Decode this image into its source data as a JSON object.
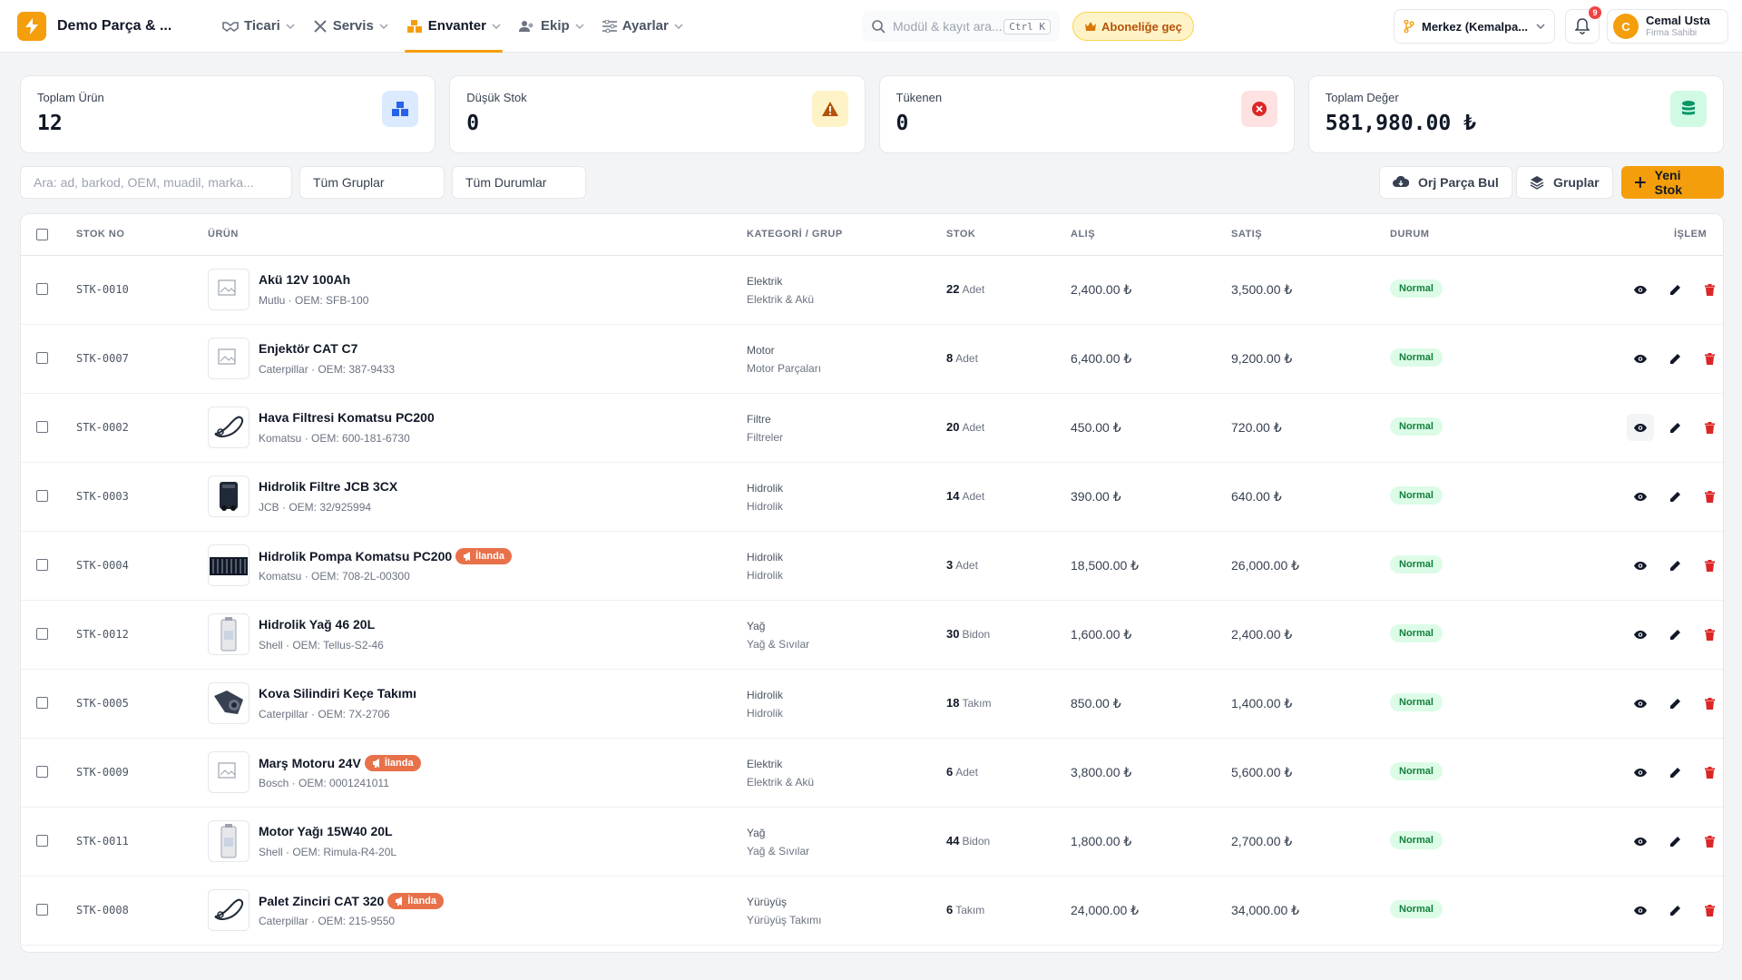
{
  "brand": {
    "name": "Demo Parça & ..."
  },
  "nav": [
    {
      "label": "Ticari",
      "icon": "handshake-icon"
    },
    {
      "label": "Servis",
      "icon": "wrench-icon"
    },
    {
      "label": "Envanter",
      "icon": "boxes-icon",
      "active": true
    },
    {
      "label": "Ekip",
      "icon": "users-icon"
    },
    {
      "label": "Ayarlar",
      "icon": "sliders-icon"
    }
  ],
  "search": {
    "placeholder": "Modül & kayıt ara...",
    "shortcut": "Ctrl K"
  },
  "subscribe": {
    "label": "Aboneliğe geç"
  },
  "branch": {
    "label": "Merkez (Kemalpa..."
  },
  "notifications": {
    "count": "9"
  },
  "user": {
    "initial": "C",
    "name": "Cemal Usta",
    "role": "Firma Sahibi"
  },
  "stats": [
    {
      "label": "Toplam Ürün",
      "value": "12",
      "icon": "boxes-icon",
      "color": "#2563eb",
      "bg": "#dbeafe"
    },
    {
      "label": "Düşük Stok",
      "value": "0",
      "icon": "warning-icon",
      "color": "#b45309",
      "bg": "#fef3c7"
    },
    {
      "label": "Tükenen",
      "value": "0",
      "icon": "x-circle-icon",
      "color": "#dc2626",
      "bg": "#fee2e2"
    },
    {
      "label": "Toplam Değer",
      "value": "581,980.00 ₺",
      "icon": "coins-icon",
      "color": "#059669",
      "bg": "#d1fae5"
    }
  ],
  "filters": {
    "search_placeholder": "Ara: ad, barkod, OEM, muadil, marka...",
    "group_select": "Tüm Gruplar",
    "status_select": "Tüm Durumlar",
    "find_part": "Orj Parça Bul",
    "groups": "Gruplar",
    "new_stock": "Yeni Stok"
  },
  "table": {
    "headers": {
      "stock_no": "STOK NO",
      "product": "ÜRÜN",
      "category": "KATEGORİ / GRUP",
      "stock": "STOK",
      "buy": "ALIŞ",
      "sell": "SATIŞ",
      "status": "DURUM",
      "action": "İŞLEM"
    },
    "listing_badge": "İlanda",
    "rows": [
      {
        "code": "STK-0010",
        "name": "Akü 12V 100Ah",
        "sub": "Mutlu · OEM: SFB-100",
        "cat": "Elektrik",
        "group": "Elektrik & Akü",
        "qty": "22",
        "unit": "Adet",
        "buy": "2,400.00 ₺",
        "sell": "3,500.00 ₺",
        "status": "Normal",
        "listed": false,
        "thumb": "broken-image-icon"
      },
      {
        "code": "STK-0007",
        "name": "Enjektör CAT C7",
        "sub": "Caterpillar · OEM: 387-9433",
        "cat": "Motor",
        "group": "Motor Parçaları",
        "qty": "8",
        "unit": "Adet",
        "buy": "6,400.00 ₺",
        "sell": "9,200.00 ₺",
        "status": "Normal",
        "listed": false,
        "thumb": "broken-image-icon"
      },
      {
        "code": "STK-0002",
        "name": "Hava Filtresi Komatsu PC200",
        "sub": "Komatsu · OEM: 600-181-6730",
        "cat": "Filtre",
        "group": "Filtreler",
        "qty": "20",
        "unit": "Adet",
        "buy": "450.00 ₺",
        "sell": "720.00 ₺",
        "status": "Normal",
        "listed": false,
        "thumb": "chain-thumb"
      },
      {
        "code": "STK-0003",
        "name": "Hidrolik Filtre JCB 3CX",
        "sub": "JCB · OEM: 32/925994",
        "cat": "Hidrolik",
        "group": "Hidrolik",
        "qty": "14",
        "unit": "Adet",
        "buy": "390.00 ₺",
        "sell": "640.00 ₺",
        "status": "Normal",
        "listed": false,
        "thumb": "filter-thumb"
      },
      {
        "code": "STK-0004",
        "name": "Hidrolik Pompa Komatsu PC200",
        "sub": "Komatsu · OEM: 708-2L-00300",
        "cat": "Hidrolik",
        "group": "Hidrolik",
        "qty": "3",
        "unit": "Adet",
        "buy": "18,500.00 ₺",
        "sell": "26,000.00 ₺",
        "status": "Normal",
        "listed": true,
        "thumb": "pump-thumb"
      },
      {
        "code": "STK-0012",
        "name": "Hidrolik Yağ 46 20L",
        "sub": "Shell · OEM: Tellus-S2-46",
        "cat": "Yağ",
        "group": "Yağ & Sıvılar",
        "qty": "30",
        "unit": "Bidon",
        "buy": "1,600.00 ₺",
        "sell": "2,400.00 ₺",
        "status": "Normal",
        "listed": false,
        "thumb": "canister-thumb"
      },
      {
        "code": "STK-0005",
        "name": "Kova Silindiri Keçe Takımı",
        "sub": "Caterpillar · OEM: 7X-2706",
        "cat": "Hidrolik",
        "group": "Hidrolik",
        "qty": "18",
        "unit": "Takım",
        "buy": "850.00 ₺",
        "sell": "1,400.00 ₺",
        "status": "Normal",
        "listed": false,
        "thumb": "seal-thumb"
      },
      {
        "code": "STK-0009",
        "name": "Marş Motoru 24V",
        "sub": "Bosch · OEM: 0001241011",
        "cat": "Elektrik",
        "group": "Elektrik & Akü",
        "qty": "6",
        "unit": "Adet",
        "buy": "3,800.00 ₺",
        "sell": "5,600.00 ₺",
        "status": "Normal",
        "listed": true,
        "thumb": "broken-image-icon"
      },
      {
        "code": "STK-0011",
        "name": "Motor Yağı 15W40 20L",
        "sub": "Shell · OEM: Rimula-R4-20L",
        "cat": "Yağ",
        "group": "Yağ & Sıvılar",
        "qty": "44",
        "unit": "Bidon",
        "buy": "1,800.00 ₺",
        "sell": "2,700.00 ₺",
        "status": "Normal",
        "listed": false,
        "thumb": "canister-thumb"
      },
      {
        "code": "STK-0008",
        "name": "Palet Zinciri CAT 320",
        "sub": "Caterpillar · OEM: 215-9550",
        "cat": "Yürüyüş",
        "group": "Yürüyüş Takımı",
        "qty": "6",
        "unit": "Takım",
        "buy": "24,000.00 ₺",
        "sell": "34,000.00 ₺",
        "status": "Normal",
        "listed": true,
        "thumb": "chain-thumb"
      }
    ]
  },
  "colors": {
    "accent": "#f59e0b",
    "status_ok": "#15803d",
    "listing": "#e8714a",
    "delete": "#dc2626"
  }
}
